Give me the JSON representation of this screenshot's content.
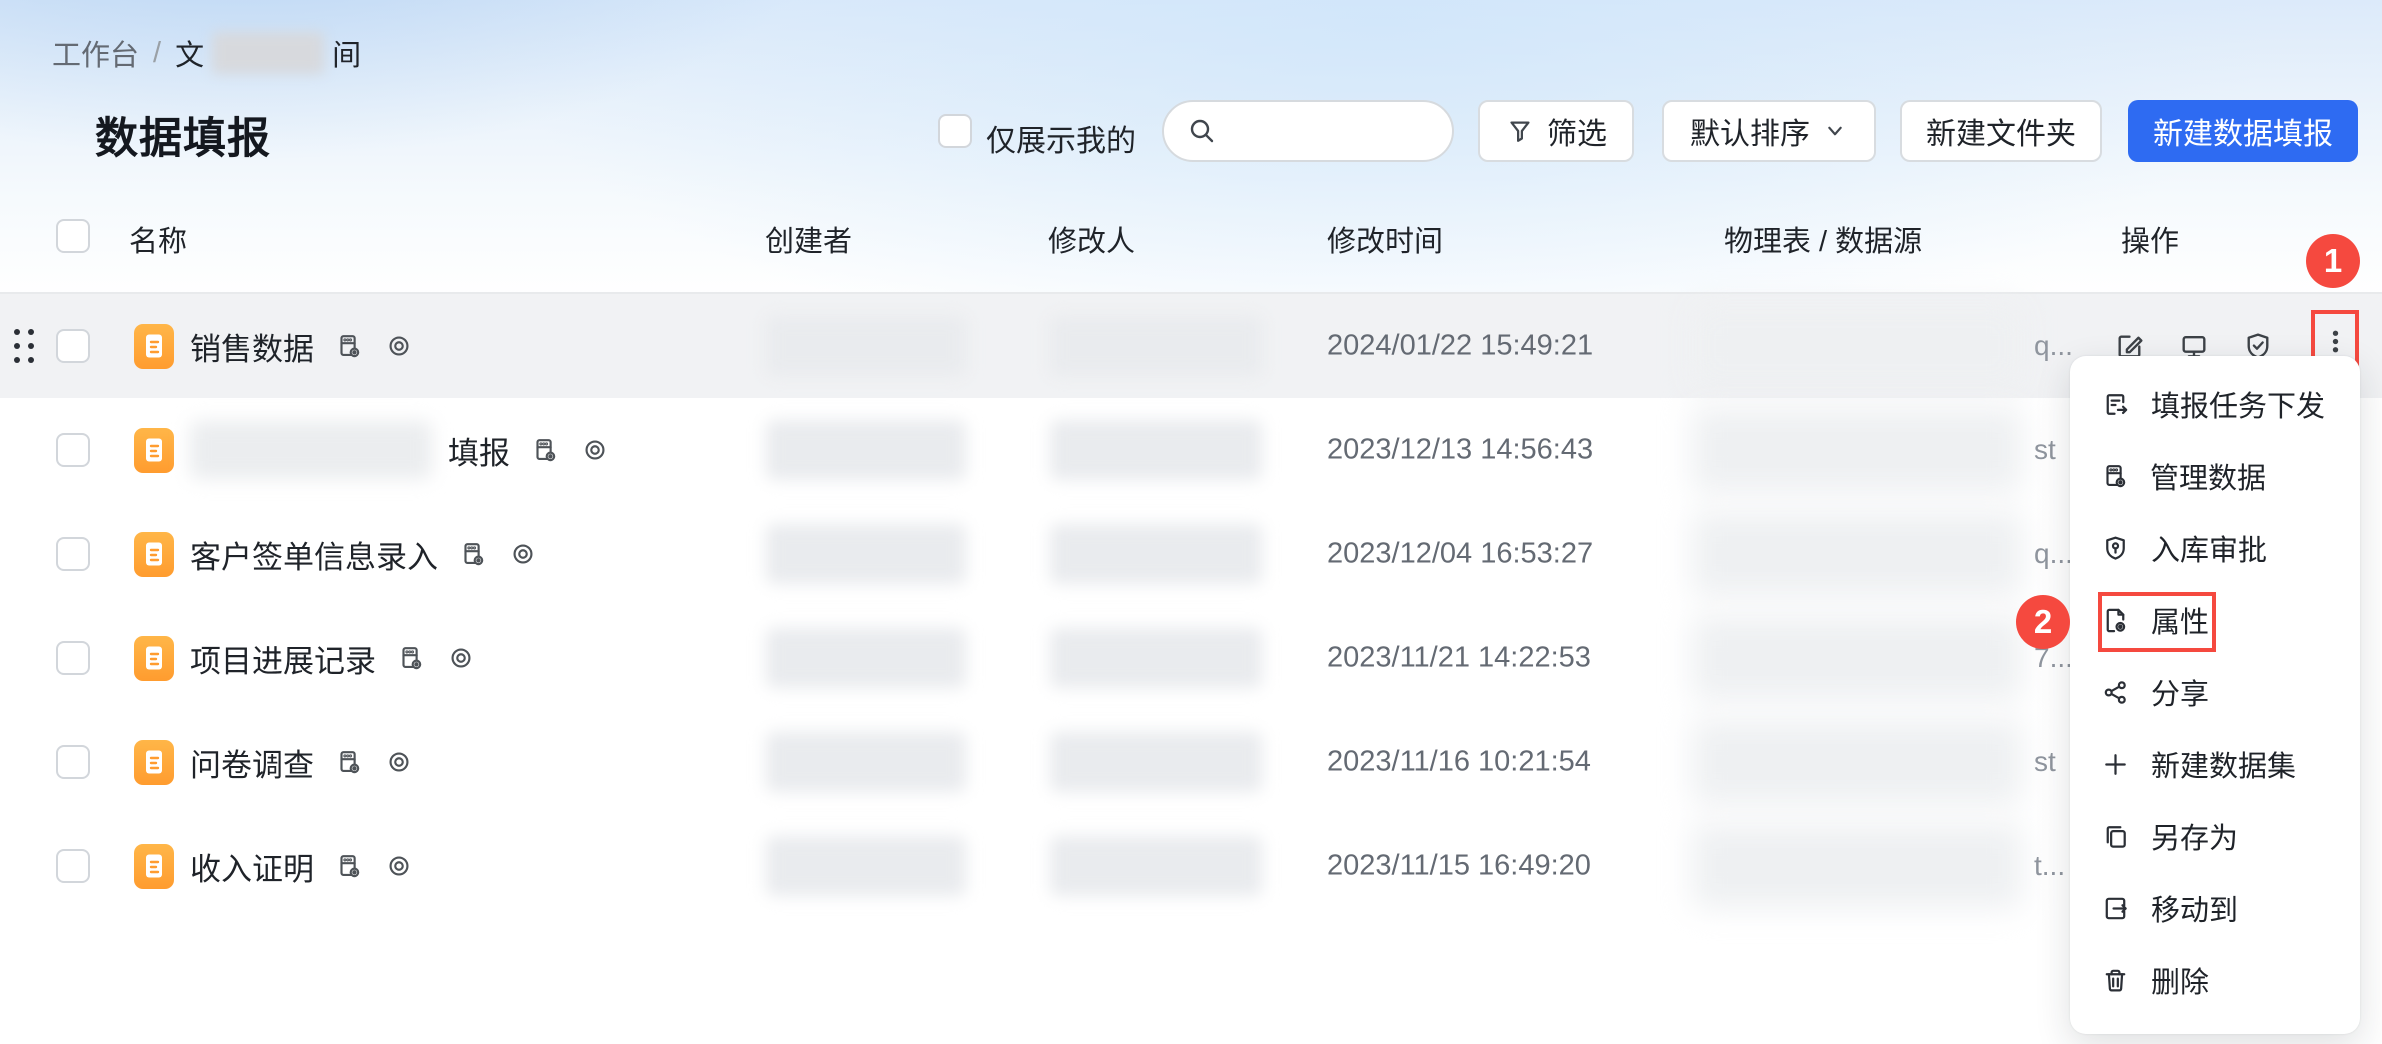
{
  "page": {
    "title": "数据填报"
  },
  "breadcrumb": {
    "root": "工作台",
    "separator": "/",
    "current_prefix": "文",
    "current_suffix": "间",
    "middle_redacted": true
  },
  "toolbar": {
    "only_mine_label": "仅展示我的",
    "search_placeholder": "",
    "filter_label": "筛选",
    "sort_label": "默认排序",
    "new_folder_label": "新建文件夹",
    "new_entry_label": "新建数据填报"
  },
  "table": {
    "headers": {
      "name": "名称",
      "creator": "创建者",
      "modifier": "修改人",
      "modified_time": "修改时间",
      "physical_source": "物理表 / 数据源",
      "actions": "操作"
    },
    "row_trailing_icons": [
      "db-manage-icon",
      "eye-icon"
    ],
    "rows": [
      {
        "name": "销售数据",
        "name_prefix_redacted": false,
        "creator_redacted": true,
        "modifier_redacted": true,
        "modified_time": "2024/01/22 15:49:21",
        "physical_source_hint": "q...",
        "highlighted": true,
        "show_actions": true,
        "show_drag_handle": true
      },
      {
        "name": "填报",
        "name_prefix_redacted": true,
        "creator_redacted": true,
        "modifier_redacted": true,
        "modified_time": "2023/12/13 14:56:43",
        "physical_source_hint": "st",
        "highlighted": false,
        "show_actions": false,
        "show_drag_handle": false
      },
      {
        "name": "客户签单信息录入",
        "name_prefix_redacted": false,
        "creator_redacted": true,
        "modifier_redacted": true,
        "modified_time": "2023/12/04 16:53:27",
        "physical_source_hint": "q...",
        "highlighted": false,
        "show_actions": false,
        "show_drag_handle": false
      },
      {
        "name": "项目进展记录",
        "name_prefix_redacted": false,
        "creator_redacted": true,
        "modifier_redacted": true,
        "modified_time": "2023/11/21 14:22:53",
        "physical_source_hint": "7...",
        "highlighted": false,
        "show_actions": false,
        "show_drag_handle": false
      },
      {
        "name": "问卷调查",
        "name_prefix_redacted": false,
        "creator_redacted": true,
        "modifier_redacted": true,
        "modified_time": "2023/11/16 10:21:54",
        "physical_source_hint": "st",
        "highlighted": false,
        "show_actions": false,
        "show_drag_handle": false
      },
      {
        "name": "收入证明",
        "name_prefix_redacted": false,
        "creator_redacted": true,
        "modifier_redacted": true,
        "modified_time": "2023/11/15 16:49:20",
        "physical_source_hint": "t...",
        "highlighted": false,
        "show_actions": false,
        "show_drag_handle": false
      }
    ],
    "row_actions": [
      {
        "icon": "edit-icon"
      },
      {
        "icon": "monitor-icon"
      },
      {
        "icon": "shield-check-icon"
      },
      {
        "icon": "more-vertical-icon",
        "highlight_boxed": true
      }
    ]
  },
  "context_menu": {
    "items": [
      {
        "icon": "task-send-icon",
        "label": "填报任务下发",
        "highlight_boxed": false
      },
      {
        "icon": "db-manage-icon",
        "label": "管理数据",
        "highlight_boxed": false
      },
      {
        "icon": "shield-key-icon",
        "label": "入库审批",
        "highlight_boxed": false
      },
      {
        "icon": "doc-gear-icon",
        "label": "属性",
        "highlight_boxed": true
      },
      {
        "icon": "share-icon",
        "label": "分享",
        "highlight_boxed": false
      },
      {
        "icon": "plus-icon",
        "label": "新建数据集",
        "highlight_boxed": false
      },
      {
        "icon": "copy-icon",
        "label": "另存为",
        "highlight_boxed": false
      },
      {
        "icon": "move-icon",
        "label": "移动到",
        "highlight_boxed": false
      },
      {
        "icon": "trash-icon",
        "label": "删除",
        "highlight_boxed": false
      }
    ]
  },
  "annotations": {
    "step_1": "1",
    "step_2": "2",
    "annotation_color": "#f5493f"
  },
  "colors": {
    "primary_blue": "#2e6bf2",
    "doc_icon_orange": "#ffa23c",
    "row_highlight": "#f1f2f4"
  }
}
